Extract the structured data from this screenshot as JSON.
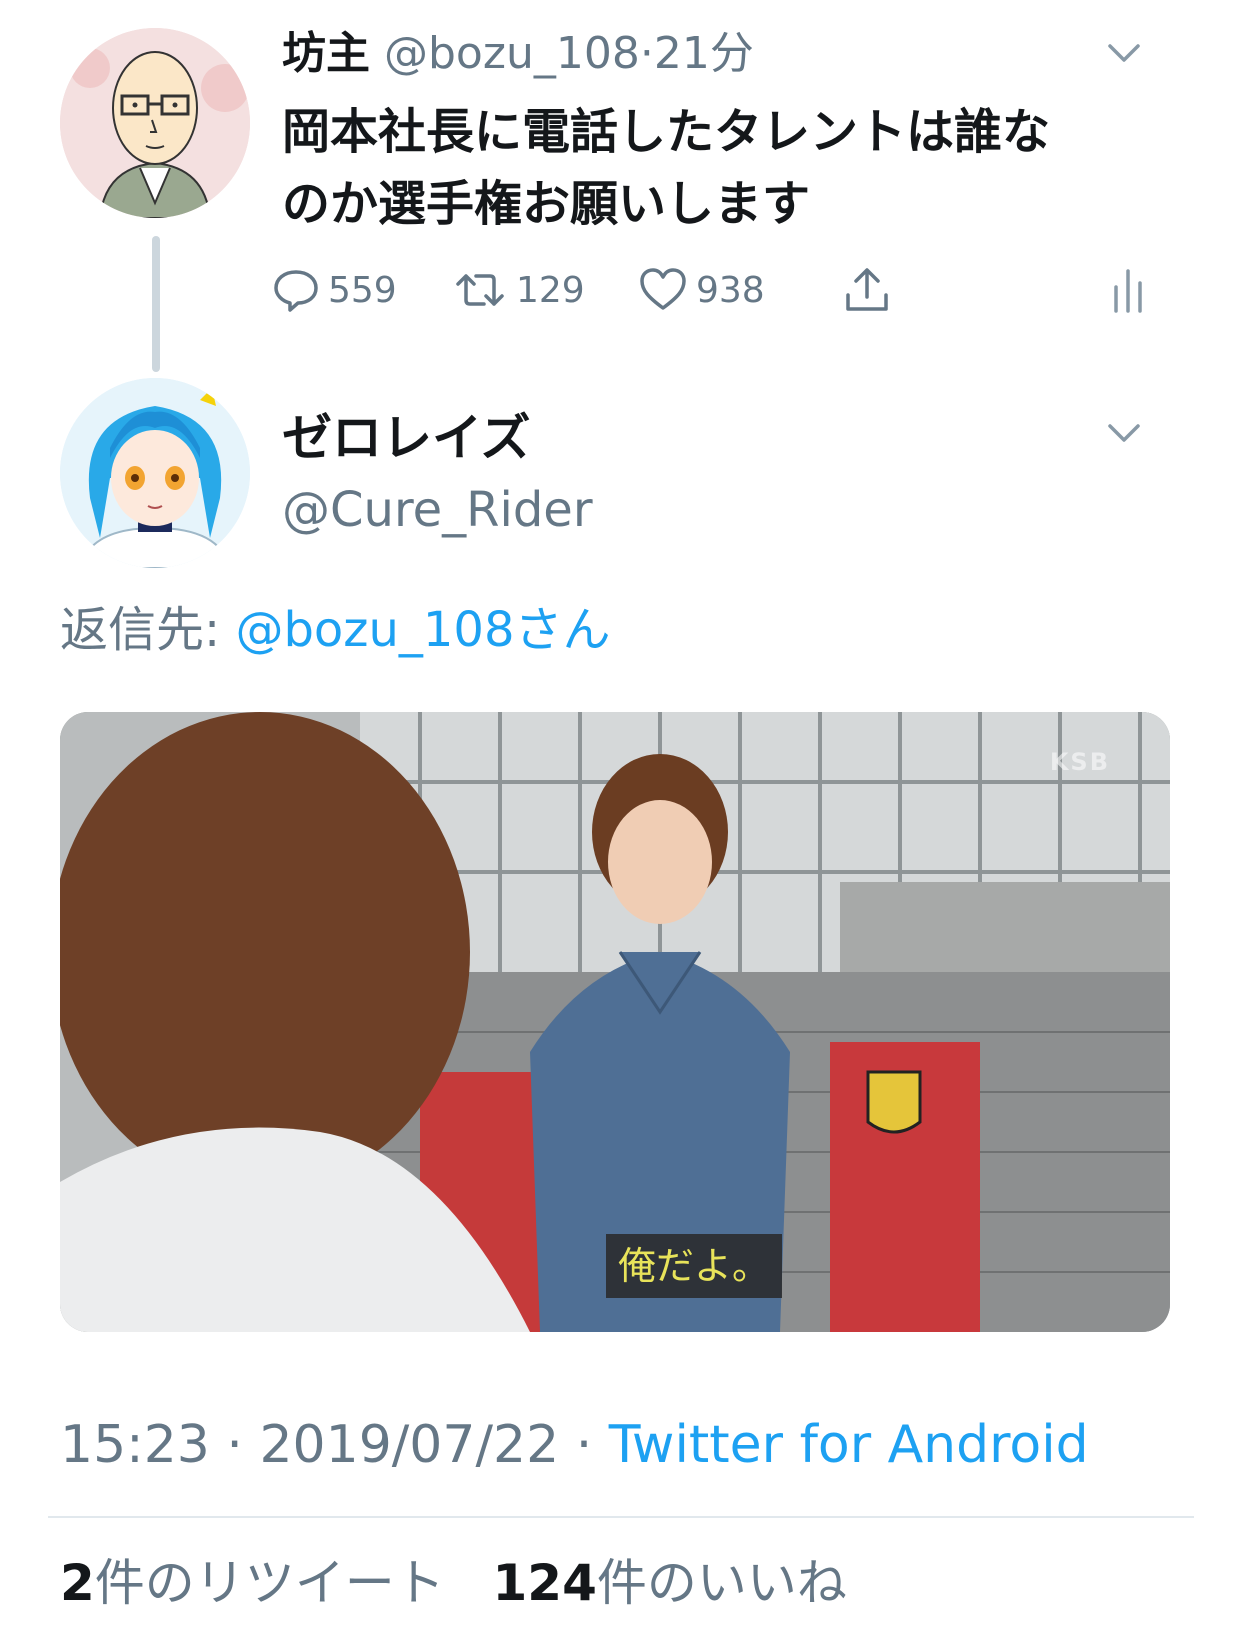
{
  "parent_tweet": {
    "name": "坊主",
    "handle": "@bozu_108",
    "time": "21分",
    "text_line1": "岡本社長に電話したタレントは誰な",
    "text_line2": "のか選手権お願いします",
    "replies": "559",
    "retweets": "129",
    "likes": "938"
  },
  "reply_tweet": {
    "name": "ゼロレイズ",
    "handle": "@Cure_Rider",
    "reply_label": "返信先: ",
    "reply_mention": "@bozu_108さん",
    "media": {
      "subtitle": "俺だよ。",
      "watermark": "KSB"
    },
    "time": "15:23",
    "date": "2019/07/22",
    "source": "Twitter for Android",
    "retweet_count": "2",
    "retweet_label": "件のリツイート",
    "like_count": "124",
    "like_label": "件のいいね"
  },
  "colors": {
    "link": "#1da1f2",
    "secondary": "#657786",
    "text": "#14171a",
    "thread_line": "#ccd6dd"
  }
}
